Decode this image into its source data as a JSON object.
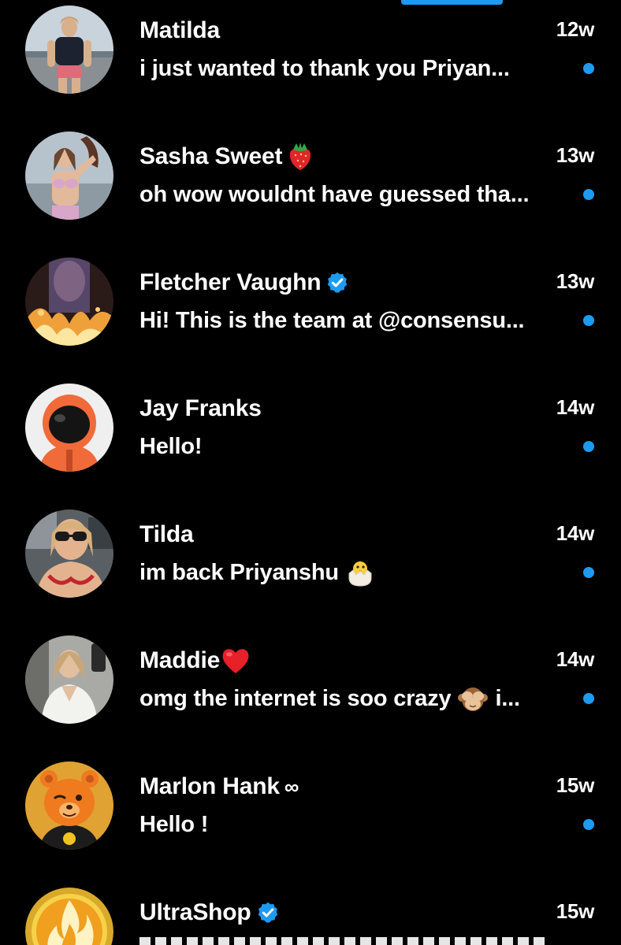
{
  "colors": {
    "background": "#000000",
    "text": "#ffffff",
    "accent": "#1d9bf0"
  },
  "conversations": [
    {
      "name": "Matilda",
      "time": "12w",
      "preview": "i just wanted to thank you  Priyan...",
      "unread": true,
      "avatar_icon": "avatar-photo-woman-outdoor"
    },
    {
      "name": "Sasha Sweet",
      "name_emoji": "strawberry-emoji",
      "time": "13w",
      "preview": "oh wow wouldnt have guessed tha...",
      "unread": true,
      "avatar_icon": "avatar-photo-woman-bikini"
    },
    {
      "name": "Fletcher Vaughn",
      "name_badge": "verified-badge-icon",
      "time": "13w",
      "preview": "Hi! This is the team at @consensu...",
      "unread": true,
      "avatar_icon": "avatar-photo-fire"
    },
    {
      "name": "Jay Franks",
      "time": "14w",
      "preview": "Hello!",
      "unread": true,
      "avatar_icon": "avatar-astronaut"
    },
    {
      "name": "Tilda",
      "time": "14w",
      "preview_before": "im back Priyanshu",
      "preview_emoji": "hatching-chick-emoji",
      "preview_after": "",
      "unread": true,
      "avatar_icon": "avatar-photo-woman-sunglasses"
    },
    {
      "name": "Maddie",
      "name_emoji": "red-heart-emoji",
      "time": "14w",
      "preview_before": "omg the internet is soo crazy",
      "preview_emoji": "see-no-evil-monkey-emoji",
      "preview_after": "i...",
      "unread": true,
      "avatar_icon": "avatar-photo-woman-selfie"
    },
    {
      "name": "Marlon Hank",
      "name_suffix": "∞",
      "time": "15w",
      "preview": "Hello !",
      "unread": true,
      "avatar_icon": "avatar-orange-bear-mascot"
    },
    {
      "name": "UltraShop",
      "name_badge": "verified-badge-icon",
      "time": "15w",
      "unread": false,
      "avatar_icon": "avatar-gold-flame-logo"
    }
  ]
}
